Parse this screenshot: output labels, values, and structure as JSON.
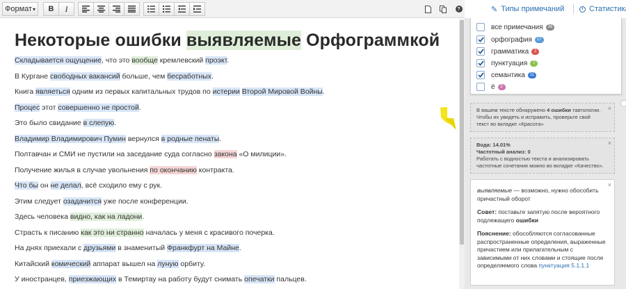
{
  "toolbar": {
    "format_label": "Формат",
    "format_caret": "▾",
    "bold_label": "B",
    "italic_label": "I",
    "tab_types": "Типы примечаний",
    "tab_stats": "Статистика",
    "help_label": "?"
  },
  "editor": {
    "title": [
      "Некоторые ошибки ",
      "выявляемые",
      " Орфограммкой"
    ],
    "lines": [
      [
        [
          "Складывается ощущение",
          "b"
        ],
        [
          ", что это ",
          ""
        ],
        [
          "вообще",
          "g"
        ],
        [
          " кремлевский ",
          ""
        ],
        [
          "проэкт",
          "b"
        ],
        [
          ".",
          ""
        ]
      ],
      [
        [
          "В Кургане ",
          ""
        ],
        [
          "свободных вакансий",
          "b"
        ],
        [
          " больше, чем ",
          ""
        ],
        [
          "бесработных",
          "b"
        ],
        [
          ".",
          ""
        ]
      ],
      [
        [
          "Книга ",
          ""
        ],
        [
          "являеться",
          "b"
        ],
        [
          " одним из первых капитальных трудов по ",
          ""
        ],
        [
          "истерии",
          "b"
        ],
        [
          " ",
          ""
        ],
        [
          "Второй Мировой Войны",
          "b"
        ],
        [
          ".",
          ""
        ]
      ],
      [
        [
          "Процес",
          "b"
        ],
        [
          " этот ",
          ""
        ],
        [
          "совершенно не простой",
          "b"
        ],
        [
          ".",
          ""
        ]
      ],
      [
        [
          "Это было свидание ",
          ""
        ],
        [
          "в слепую",
          "b"
        ],
        [
          ".",
          ""
        ]
      ],
      [
        [
          "Владимир Владимирович Пумин",
          "b"
        ],
        [
          " вернулся ",
          ""
        ],
        [
          "в родные пенаты",
          "b"
        ],
        [
          ".",
          ""
        ]
      ],
      [
        [
          "Полтавчан и СМИ не пустили на заседание суда согласно ",
          ""
        ],
        [
          "закона",
          "r"
        ],
        [
          " «О милиции».",
          ""
        ]
      ],
      [
        [
          "Получение жилья в случае увольнения ",
          ""
        ],
        [
          "по окончанию",
          "r"
        ],
        [
          " контракта.",
          ""
        ]
      ],
      [
        [
          "Что бы",
          "b"
        ],
        [
          " он ",
          ""
        ],
        [
          "не делал",
          "b"
        ],
        [
          ", всё сходило ему с рук.",
          ""
        ]
      ],
      [
        [
          "Этим следует ",
          ""
        ],
        [
          "озадачится",
          "b"
        ],
        [
          " уже после конференции.",
          ""
        ]
      ],
      [
        [
          "Здесь человека ",
          ""
        ],
        [
          "видно, как на ладони",
          "g"
        ],
        [
          ".",
          ""
        ]
      ],
      [
        [
          "Страсть к писанию ",
          ""
        ],
        [
          "как это ни странно",
          "g"
        ],
        [
          " началась у меня с красивого почерка.",
          ""
        ]
      ],
      [
        [
          "На днях приехали с ",
          ""
        ],
        [
          "друзьями",
          "b"
        ],
        [
          " в знаменитый ",
          ""
        ],
        [
          "Франкфурт на Майне",
          "b"
        ],
        [
          ".",
          ""
        ]
      ],
      [
        [
          "Китайский ",
          ""
        ],
        [
          "комический",
          "b"
        ],
        [
          " аппарат вышел на ",
          ""
        ],
        [
          "луную",
          "b"
        ],
        [
          " орбиту.",
          ""
        ]
      ],
      [
        [
          "У иностранцев, ",
          ""
        ],
        [
          "приезжающих",
          "b"
        ],
        [
          " в Темиртау на работу будут снимать ",
          ""
        ],
        [
          "опечатки",
          "b"
        ],
        [
          " пальцев.",
          ""
        ]
      ]
    ]
  },
  "filters": [
    {
      "label": "все примечания",
      "count": "39",
      "checked": false,
      "color": "#8a8a8a"
    },
    {
      "label": "орфография",
      "count": "17",
      "checked": true,
      "color": "#5b9bd5"
    },
    {
      "label": "грамматика",
      "count": "2",
      "checked": true,
      "color": "#d9534f"
    },
    {
      "label": "пунктуация",
      "count": "7",
      "checked": true,
      "color": "#8cc152"
    },
    {
      "label": "семантика",
      "count": "11",
      "checked": true,
      "color": "#3a7bd5"
    },
    {
      "label": "ё",
      "count": "2",
      "checked": false,
      "color": "#c878b4"
    }
  ],
  "notes": {
    "tautology": {
      "line1_pre": "В вашем тексте обнаружено ",
      "line1_bold": "4 ошибки",
      "line1_post": " тавтологии.",
      "line2": "Чтобы их увидеть и исправить, проверьте свой",
      "line3": "текст во вкладке «Красота»"
    },
    "water": {
      "line1": "Вода: 14.01%",
      "line2": "Частотный анализ: 0",
      "line3": "Работать с водностью текста и анализировать",
      "line4": "частотные сочетания можно во вкладке «Качество»."
    },
    "card": {
      "word": "выявляемые",
      "intro": " — возможно, нужно обособить причастный оборот",
      "advice_label": "Совет:",
      "advice_text": " поставьте запятую после вероятного подлежащего ",
      "advice_bold": "ошибки",
      "expl_label": "Пояснение:",
      "expl_text": " обособляются согласованные распространенные определения, выраженные причастием или прилагательным с зависимыми от них словами и стоящие после определяемого слова ",
      "expl_link": "пунктуация 5.1.1.1"
    },
    "close": "×"
  }
}
